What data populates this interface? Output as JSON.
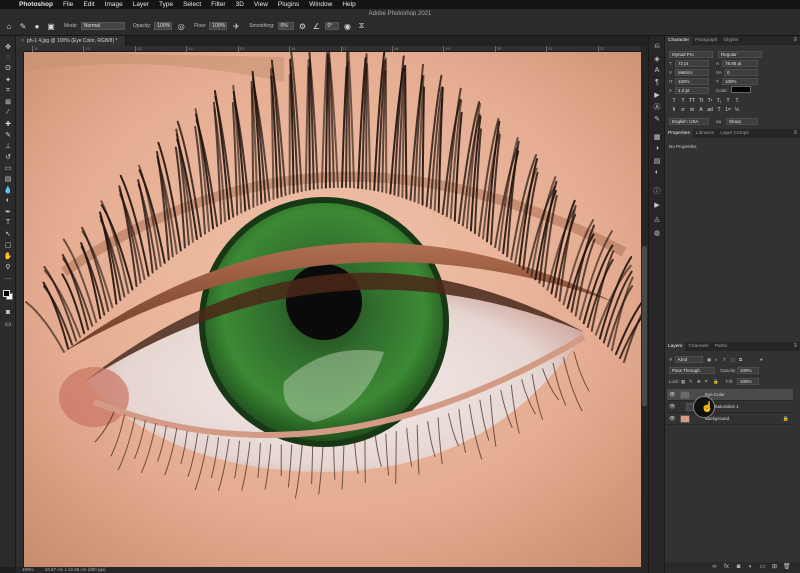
{
  "menubar": {
    "app_name": "Photoshop",
    "items": [
      "File",
      "Edit",
      "Image",
      "Layer",
      "Type",
      "Select",
      "Filter",
      "3D",
      "View",
      "Plugins",
      "Window",
      "Help"
    ]
  },
  "window": {
    "title": "Adobe Photoshop 2021"
  },
  "options": {
    "mode_label": "Mode:",
    "mode_value": "Normal",
    "opacity_label": "Opacity:",
    "opacity_value": "100%",
    "flow_label": "Flow:",
    "flow_value": "100%",
    "smoothing_label": "Smoothing:",
    "smoothing_value": "0%",
    "angle_value": "0°"
  },
  "document": {
    "tab_label": "ph-1 4.jpg @ 100% (Eye Color, RGB/8) *"
  },
  "ruler": {
    "top_marks": [
      "11",
      "12",
      "13",
      "14",
      "15",
      "16",
      "17",
      "18",
      "19",
      "20",
      "21",
      "22"
    ]
  },
  "status": {
    "zoom": "100%",
    "size": "33.87 cm x 22.86 cm (300 ppi)"
  },
  "character": {
    "tabs": [
      "Character",
      "Paragraph",
      "Glyphs"
    ],
    "font_family": "Myriad Pro",
    "font_style": "Regular",
    "font_size": "72 pt",
    "leading": "78.88 pt",
    "kerning": "Metrics",
    "tracking": "0",
    "vscale": "100%",
    "hscale": "100%",
    "baseline": "1.2 pt",
    "color_label": "Color:",
    "language": "English: USA",
    "antialias": "Sharp",
    "type_buttons": [
      "T",
      "T",
      "TT",
      "Tt",
      "T¹",
      "T₁",
      "T",
      "T"
    ]
  },
  "properties": {
    "tabs": [
      "Properties",
      "Libraries",
      "Layer Comps"
    ],
    "empty_text": "No Properties"
  },
  "layers": {
    "tabs": [
      "Layers",
      "Channels",
      "Paths"
    ],
    "filter_kind": "Kind",
    "blend_mode": "Pass Through",
    "opacity_label": "Opacity:",
    "opacity_value": "100%",
    "lock_label": "Lock:",
    "fill_label": "Fill:",
    "fill_value": "100%",
    "items": [
      {
        "name": "Eye Color"
      },
      {
        "name": "Hue/Saturation 1"
      },
      {
        "name": "Background"
      }
    ]
  },
  "colors": {
    "iris": "#2f6b2c",
    "skin": "#e8b59c",
    "panel": "#323232"
  }
}
